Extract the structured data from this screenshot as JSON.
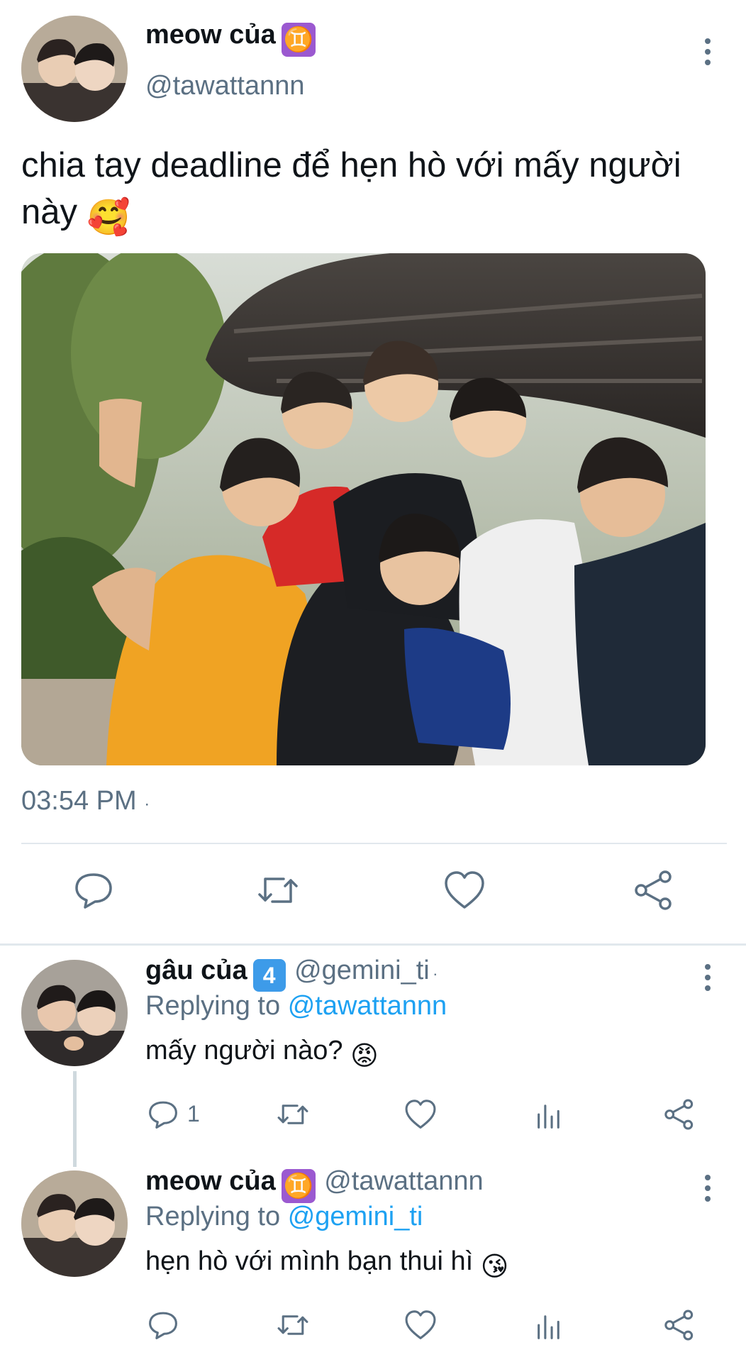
{
  "main_tweet": {
    "display_name": "meow của",
    "zodiac_badge": "♊",
    "handle": "@tawattannn",
    "text": "chia tay deadline để hẹn hò với mấy người này",
    "text_emoji": "🥰",
    "timestamp": "03:54 PM",
    "timestamp_separator": "·"
  },
  "replies": [
    {
      "display_name": "gâu của",
      "badge": "4",
      "handle": "@gemini_ti",
      "separator": "·",
      "replying_label": "Replying to",
      "replying_to": "@tawattannn",
      "text": "mấy người nào?",
      "text_emoji": "😡",
      "reply_count": "1"
    },
    {
      "display_name": "meow của",
      "badge": "♊",
      "handle": "@tawattannn",
      "replying_label": "Replying to",
      "replying_to": "@gemini_ti",
      "text": "hẹn hò với mình bạn thui hì",
      "text_emoji": "😘"
    }
  ],
  "icons": {
    "reply": "reply-icon",
    "retweet": "retweet-icon",
    "like": "heart-icon",
    "stats": "stats-icon",
    "share": "share-icon",
    "more": "more-icon"
  },
  "colors": {
    "text": "#0f1419",
    "secondary": "#5b7083",
    "mention": "#1da1f2",
    "zodiac_badge": "#9b59d0",
    "number_badge": "#3d9be9"
  }
}
